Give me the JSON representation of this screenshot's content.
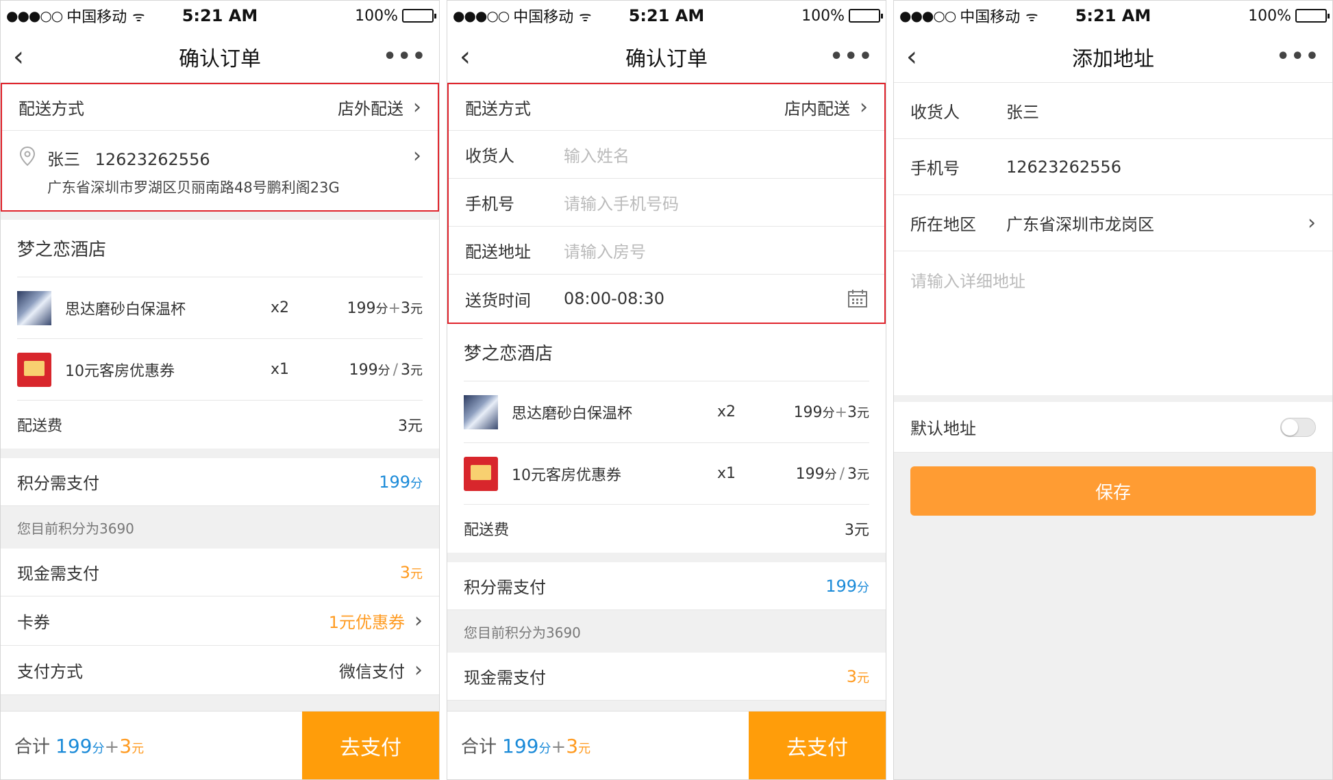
{
  "status": {
    "carrier": "中国移动",
    "time": "5:21 AM",
    "battery": "100%"
  },
  "screen1": {
    "title": "确认订单",
    "delivery_label": "配送方式",
    "delivery_value": "店外配送",
    "contact_name": "张三",
    "contact_phone": "12623262556",
    "contact_address": "广东省深圳市罗湖区贝丽南路48号鹏利阁23G",
    "shop": "梦之恋酒店",
    "items": [
      {
        "name": "思达磨砂白保温杯",
        "qty": "x2",
        "points": "199",
        "pu": "分",
        "sep": "+",
        "cash": "3",
        "cu": "元",
        "thumb": "cup-thumbnail"
      },
      {
        "name": "10元客房优惠券",
        "qty": "x1",
        "points": "199",
        "pu": "分",
        "sep": "/",
        "cash": "3",
        "cu": "元",
        "thumb": "coupon-thumbnail"
      }
    ],
    "fee_label": "配送费",
    "fee_value": "3元",
    "points_label": "积分需支付",
    "points_value": "199",
    "points_unit": "分",
    "balance_note": "您目前积分为3690",
    "cash_label": "现金需支付",
    "cash_value": "3",
    "cash_unit": "元",
    "card_label": "卡券",
    "card_value": "1元优惠券",
    "method_label": "支付方式",
    "method_value": "微信支付",
    "total_label": "合计",
    "total_points": "199",
    "total_points_unit": "分",
    "total_sep": "+",
    "total_cash": "3",
    "total_cash_unit": "元",
    "pay_button": "去支付"
  },
  "screen2": {
    "title": "确认订单",
    "delivery_label": "配送方式",
    "delivery_value": "店内配送",
    "receiver_label": "收货人",
    "receiver_placeholder": "输入姓名",
    "phone_label": "手机号",
    "phone_placeholder": "请输入手机号码",
    "address_label": "配送地址",
    "address_placeholder": "请输入房号",
    "time_label": "送货时间",
    "time_value": "08:00-08:30",
    "shop": "梦之恋酒店",
    "items": [
      {
        "name": "思达磨砂白保温杯",
        "qty": "x2",
        "points": "199",
        "pu": "分",
        "sep": "+",
        "cash": "3",
        "cu": "元"
      },
      {
        "name": "10元客房优惠券",
        "qty": "x1",
        "points": "199",
        "pu": "分",
        "sep": "/",
        "cash": "3",
        "cu": "元"
      }
    ],
    "fee_label": "配送费",
    "fee_value": "3元",
    "points_label": "积分需支付",
    "points_value": "199",
    "points_unit": "分",
    "balance_note": "您目前积分为3690",
    "cash_label": "现金需支付",
    "cash_value": "3",
    "cash_unit": "元",
    "total_label": "合计",
    "total_points": "199",
    "total_points_unit": "分",
    "total_sep": "+",
    "total_cash": "3",
    "total_cash_unit": "元",
    "pay_button": "去支付"
  },
  "screen3": {
    "title": "添加地址",
    "receiver_label": "收货人",
    "receiver_value": "张三",
    "phone_label": "手机号",
    "phone_value": "12623262556",
    "region_label": "所在地区",
    "region_value": "广东省深圳市龙岗区",
    "detail_placeholder": "请输入详细地址",
    "default_label": "默认地址",
    "default_on": false,
    "save_button": "保存"
  },
  "colors": {
    "accent_orange": "#ff9d0a",
    "points_blue": "#1a8ad8",
    "highlight_red": "#e0232b"
  }
}
